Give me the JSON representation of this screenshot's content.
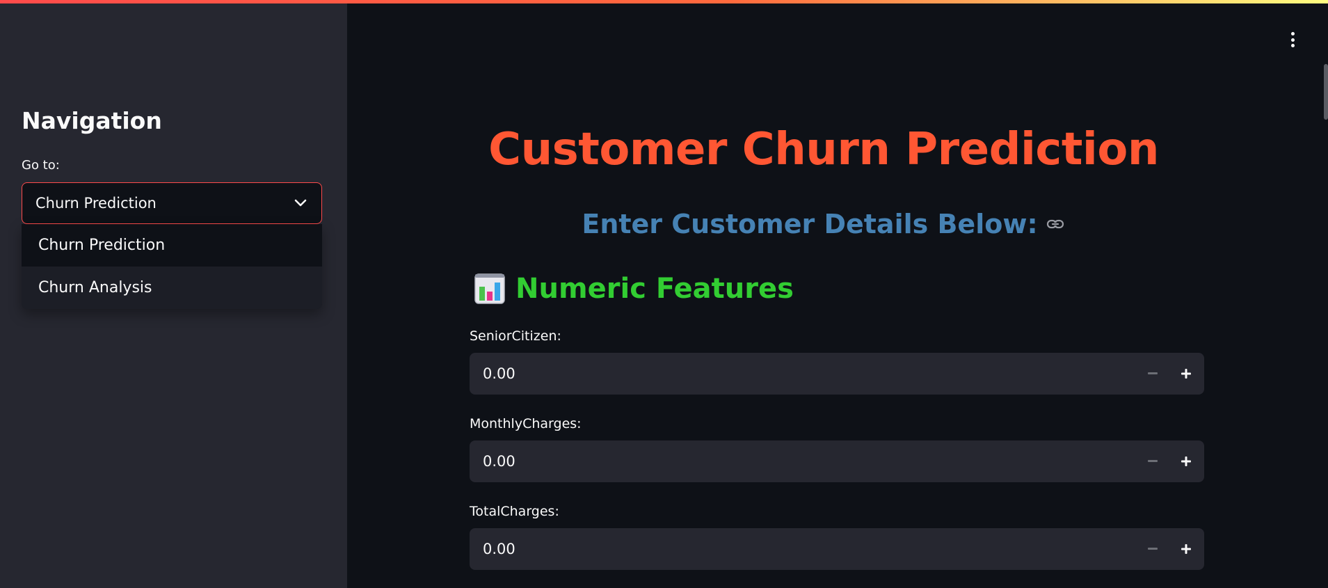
{
  "sidebar": {
    "title": "Navigation",
    "goto_label": "Go to:",
    "selected": "Churn Prediction",
    "options": [
      {
        "label": "Churn Prediction"
      },
      {
        "label": "Churn Analysis"
      }
    ]
  },
  "main": {
    "title": "Customer Churn Prediction",
    "subtitle": "Enter Customer Details Below:",
    "section": {
      "title": "Numeric Features",
      "icon": "bar-chart-icon"
    },
    "fields": [
      {
        "label": "SeniorCitizen:",
        "value": "0.00"
      },
      {
        "label": "MonthlyCharges:",
        "value": "0.00"
      },
      {
        "label": "TotalCharges:",
        "value": "0.00"
      }
    ]
  },
  "colors": {
    "title": "#ff5733",
    "subtitle": "#4682b4",
    "section": "#32cd32",
    "accent": "#ff4b4b",
    "background": "#0e1117",
    "sidebar": "#262730"
  }
}
